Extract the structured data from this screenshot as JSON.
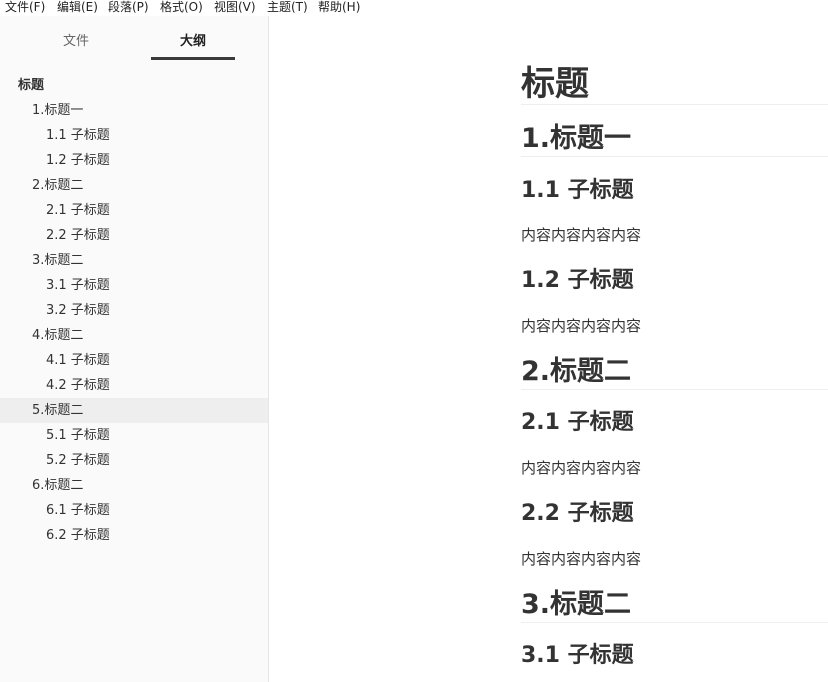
{
  "menubar": {
    "items": [
      "文件(F)",
      "编辑(E)",
      "段落(P)",
      "格式(O)",
      "视图(V)",
      "主题(T)",
      "帮助(H)"
    ]
  },
  "sidebar": {
    "tabs": {
      "files": "文件",
      "outline": "大纲"
    },
    "outline": [
      "标题",
      "1.标题一",
      "1.1 子标题",
      "1.2 子标题",
      "2.标题二",
      "2.1 子标题",
      "2.2 子标题",
      "3.标题二",
      "3.1 子标题",
      "3.2 子标题",
      "4.标题二",
      "4.1 子标题",
      "4.2 子标题",
      "5.标题二",
      "5.1 子标题",
      "5.2 子标题",
      "6.标题二",
      "6.1 子标题",
      "6.2 子标题"
    ]
  },
  "document": {
    "title": "标题",
    "h2_1": "1.标题一",
    "h3_1_1": "1.1 子标题",
    "p_1_1": "内容内容内容内容",
    "h3_1_2": "1.2 子标题",
    "p_1_2": "内容内容内容内容",
    "h2_2": "2.标题二",
    "h3_2_1": "2.1 子标题",
    "p_2_1": "内容内容内容内容",
    "h3_2_2": "2.2 子标题",
    "p_2_2": "内容内容内容内容",
    "h2_3": "3.标题二",
    "h3_3_1": "3.1 子标题"
  }
}
